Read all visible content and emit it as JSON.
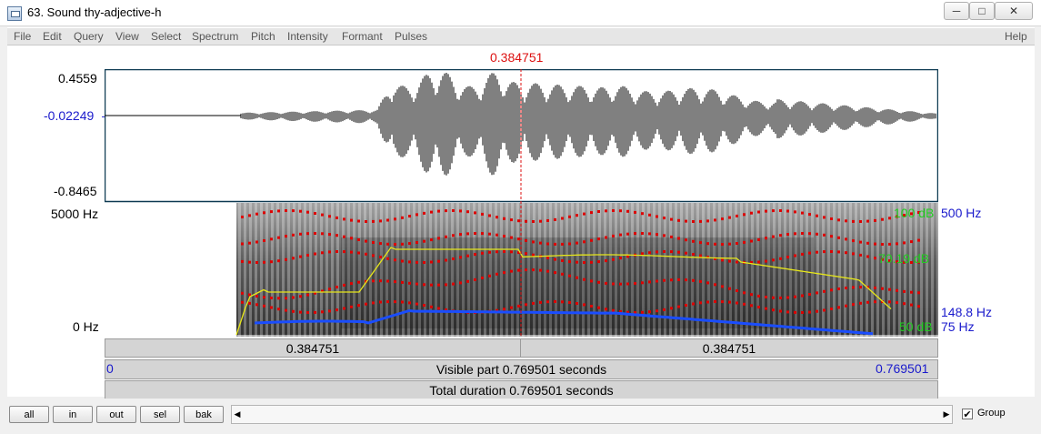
{
  "window": {
    "title": "63. Sound thy-adjective-h",
    "minimize": "─",
    "maximize": "□",
    "close": "✕"
  },
  "menu": [
    "File",
    "Edit",
    "Query",
    "View",
    "Select",
    "Spectrum",
    "Pitch",
    "Intensity",
    "Formant",
    "Pulses"
  ],
  "help": "Help",
  "cursor": {
    "time_label": "0.384751",
    "time_fraction": 0.5
  },
  "waveform": {
    "max_label": "0.4559",
    "cursor_value_label": "-0.02249",
    "min_label": "-0.8465"
  },
  "spectrogram": {
    "freq_max_label": "5000 Hz",
    "freq_min_label": "0 Hz",
    "intensity_max_label": "100 dB",
    "intensity_mid_label": "70.19 dB",
    "intensity_min_label": "50 dB",
    "pitch_max_label": "500 Hz",
    "pitch_value_label": "148.8 Hz",
    "pitch_min_label": "75 Hz"
  },
  "time_bars": {
    "left_segment": "0.384751",
    "right_segment": "0.384751",
    "visible_start": "0",
    "visible_label": "Visible part 0.769501 seconds",
    "visible_end": "0.769501",
    "total_label": "Total duration 0.769501 seconds"
  },
  "buttons": {
    "all": "all",
    "in": "in",
    "out": "out",
    "sel": "sel",
    "bak": "bak"
  },
  "scroll": {
    "left_arrow": "◀",
    "right_arrow": "▶"
  },
  "group": {
    "label": "Group",
    "checked": true,
    "check_mark": "✔"
  },
  "colors": {
    "cursor": "#dd1111",
    "pitch": "#1a4dff",
    "intensity": "#e6e61a",
    "formant": "#dd0000",
    "axis_blue": "#1a1acc",
    "db_green": "#22cc22"
  }
}
